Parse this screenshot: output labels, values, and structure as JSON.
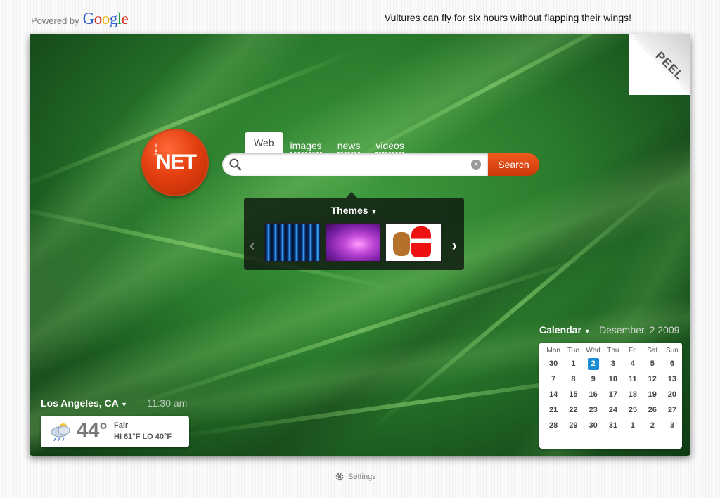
{
  "header": {
    "powered_by": "Powered by",
    "google_logo": "Google",
    "fun_fact": "Vultures can fly for six hours without flapping their wings!"
  },
  "peel": {
    "label": "PEEL"
  },
  "logo": {
    "small_text": "inzon",
    "big_text": "NET",
    "color": "#e43f10"
  },
  "search": {
    "tabs": [
      {
        "label": "Web",
        "active": true
      },
      {
        "label": "images",
        "active": false
      },
      {
        "label": "news",
        "active": false
      },
      {
        "label": "videos",
        "active": false
      }
    ],
    "query": "",
    "button_label": "Search",
    "accent": "#e04e16"
  },
  "themes": {
    "title": "Themes",
    "items": [
      "blue-lights-theme",
      "purple-wave-theme",
      "santa-reindeer-theme"
    ]
  },
  "calendar": {
    "title": "Calendar",
    "date_text": "Desember, 2 2009",
    "weekdays": [
      "Mon",
      "Tue",
      "Wed",
      "Thu",
      "Fri",
      "Sat",
      "Sun"
    ],
    "weeks": [
      [
        "30",
        "1",
        "2",
        "3",
        "4",
        "5",
        "6"
      ],
      [
        "7",
        "8",
        "9",
        "10",
        "11",
        "12",
        "13"
      ],
      [
        "14",
        "15",
        "16",
        "17",
        "18",
        "19",
        "20"
      ],
      [
        "21",
        "22",
        "23",
        "24",
        "25",
        "26",
        "27"
      ],
      [
        "28",
        "29",
        "30",
        "31",
        "1",
        "2",
        "3"
      ]
    ],
    "today": "2",
    "today_color": "#1a8fd8"
  },
  "weather": {
    "location": "Los Angeles, CA",
    "time": "11:30 am",
    "temp": "44°",
    "condition": "Fair",
    "hilo": "HI 61°F  LO 40°F",
    "icon": "cloud-rain-icon"
  },
  "footer": {
    "settings_label": "Settings"
  }
}
